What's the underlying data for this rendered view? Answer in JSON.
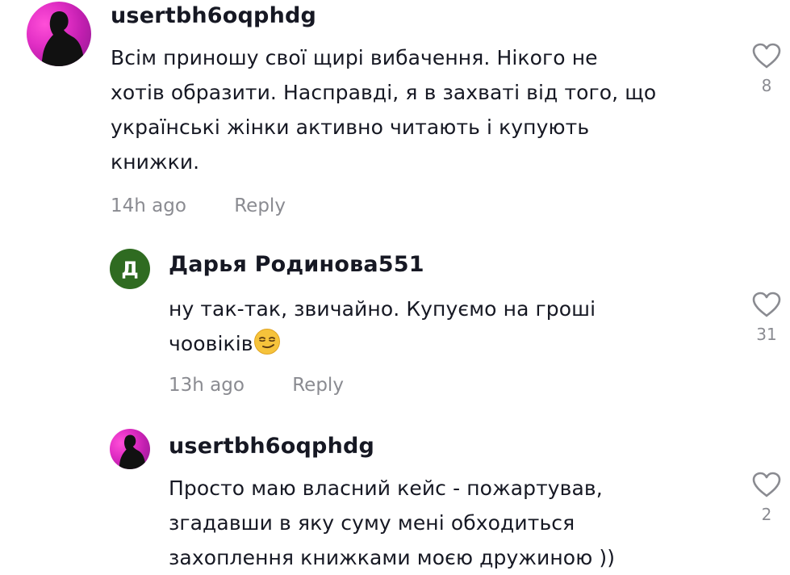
{
  "comments": [
    {
      "username": "usertbh6oqphdg",
      "avatar": "profile-photo",
      "lines": [
        "Всім приношу свої щирі вибачення. Нікого не",
        "хотів образити. Насправді, я в захваті від того, що",
        "українські жінки активно читають і купують",
        "книжки."
      ],
      "time": "14h ago",
      "reply_label": "Reply",
      "likes": "8"
    },
    {
      "username": "Дарья Родинова551",
      "avatar_letter": "Д",
      "avatar_color": "#2f6b21",
      "lines": [
        "ну так-так, звичайно. Купуємо на гроші",
        "чоовіків"
      ],
      "emoji": "smirking-face-emoji",
      "time": "13h ago",
      "reply_label": "Reply",
      "likes": "31"
    },
    {
      "username": "usertbh6oqphdg",
      "avatar": "profile-photo",
      "lines": [
        "Просто маю власний кейс - пожартував,",
        "згадавши в яку суму мені обходиться",
        "захоплення книжками моєю дружиною ))"
      ],
      "likes": "2"
    }
  ],
  "icons": {
    "like": "heart-outline-icon"
  },
  "colors": {
    "text": "#161823",
    "meta": "#8a8b91",
    "icon": "#8a8b91"
  }
}
